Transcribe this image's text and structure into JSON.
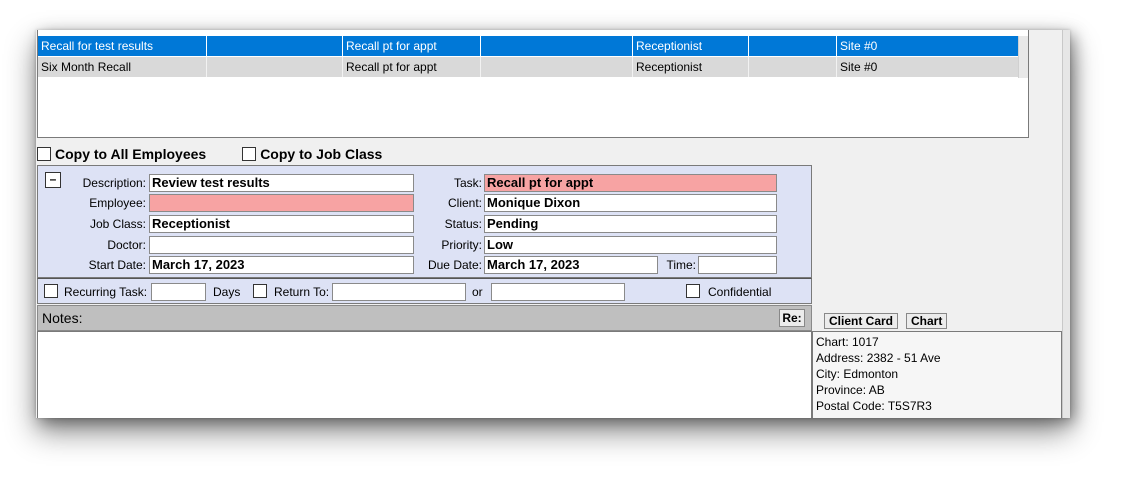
{
  "task_list": {
    "rows": [
      {
        "name": "Recall for test results",
        "blank1": "",
        "task": "Recall pt for appt",
        "blank2": "",
        "job_class": "Receptionist",
        "blank3": "",
        "site": "Site #0"
      },
      {
        "name": "Six Month Recall",
        "blank1": "",
        "task": "Recall pt for appt",
        "blank2": "",
        "job_class": "Receptionist",
        "blank3": "",
        "site": "Site #0"
      }
    ]
  },
  "copy": {
    "all_employees": "Copy to All Employees",
    "job_class": "Copy to Job Class"
  },
  "form": {
    "collapse_label": "–",
    "description_label": "Description:",
    "description_value": "Review test results",
    "employee_label": "Employee:",
    "employee_value": "",
    "job_class_label": "Job Class:",
    "job_class_value": "Receptionist",
    "doctor_label": "Doctor:",
    "doctor_value": "",
    "start_date_label": "Start Date:",
    "start_date_value": "March 17, 2023",
    "task_label": "Task:",
    "task_value": "Recall pt for appt",
    "client_label": "Client:",
    "client_value": "Monique Dixon",
    "status_label": "Status:",
    "status_value": "Pending",
    "priority_label": "Priority:",
    "priority_value": "Low",
    "due_date_label": "Due Date:",
    "due_date_value": "March 17, 2023",
    "time_label": "Time:",
    "time_value": "",
    "highlight_color": "#f7a3a3"
  },
  "recurring": {
    "recurring_label": "Recurring Task:",
    "days_label": "Days",
    "return_label": "Return To:",
    "or_label": "or",
    "confidential_label": "Confidential"
  },
  "notes": {
    "label": "Notes:",
    "re_button": "Re:",
    "content": ""
  },
  "client_buttons": {
    "client_card": "Client Card",
    "chart": "Chart"
  },
  "client_info": {
    "chart": "Chart: 1017",
    "address": "Address: 2382 - 51 Ave",
    "city": "City: Edmonton",
    "province": "Province: AB",
    "postal": "Postal Code: T5S7R3"
  },
  "colors": {
    "selected_row": "#0078d7",
    "form_background": "#dde2f5"
  }
}
